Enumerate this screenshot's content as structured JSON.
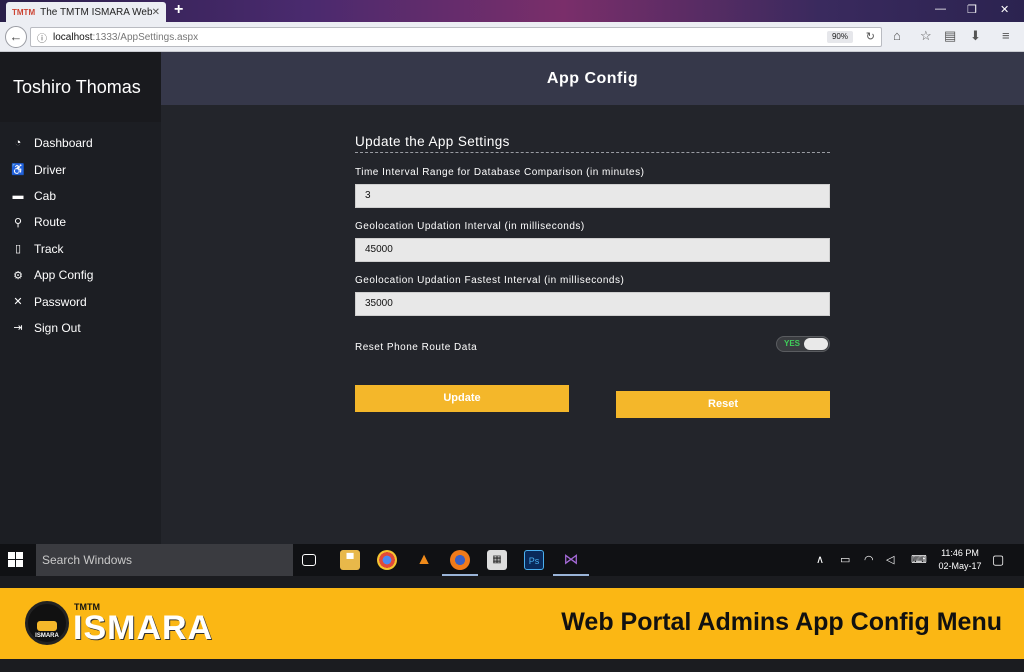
{
  "browser": {
    "tab_title": "The TMTM ISMARA Website",
    "favicon_text": "TMTM",
    "url_host": "localhost",
    "url_path": ":1333/AppSettings.aspx",
    "zoom": "90%"
  },
  "sidebar": {
    "user_name": "Toshiro Thomas",
    "items": [
      {
        "label": "Dashboard",
        "icon": "speedometer-icon"
      },
      {
        "label": "Driver",
        "icon": "driver-seat-icon"
      },
      {
        "label": "Cab",
        "icon": "cab-icon"
      },
      {
        "label": "Route",
        "icon": "map-pin-icon"
      },
      {
        "label": "Track",
        "icon": "mobile-phone-icon"
      },
      {
        "label": "App Config",
        "icon": "gear-icon"
      },
      {
        "label": "Password",
        "icon": "tools-icon"
      },
      {
        "label": "Sign Out",
        "icon": "sign-out-icon"
      }
    ]
  },
  "main": {
    "header": "App Config",
    "form_title": "Update the App Settings",
    "fields": [
      {
        "label": "Time Interval Range for Database Comparison (in minutes)",
        "value": "3"
      },
      {
        "label": "Geolocation Updation Interval (in milliseconds)",
        "value": "45000"
      },
      {
        "label": "Geolocation Updation Fastest Interval (in milliseconds)",
        "value": "35000"
      }
    ],
    "toggle": {
      "label": "Reset Phone Route Data",
      "state_text": "YES",
      "on": true
    },
    "update_button": "Update",
    "reset_button": "Reset"
  },
  "taskbar": {
    "search_placeholder": "Search Windows",
    "time": "11:46 PM",
    "date": "02-May-17"
  },
  "banner": {
    "logo_small": "TMTM",
    "logo_text": "ISMARA",
    "badge_text": "ISMARA",
    "caption": "Web Portal Admins App Config Menu"
  },
  "colors": {
    "accent": "#f4b72a",
    "banner": "#fbb714",
    "sidebar": "#1c1e23",
    "header": "#36384a"
  }
}
